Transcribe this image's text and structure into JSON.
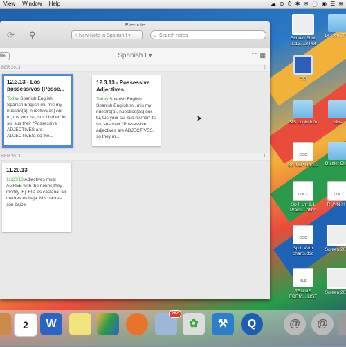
{
  "menubar": {
    "items": [
      "View",
      "Window",
      "Help"
    ],
    "status_icons": [
      "☁",
      "⊙",
      "⏱",
      "✱",
      "✉",
      "⌚",
      "◉",
      "☰",
      "≋"
    ]
  },
  "window": {
    "title": "Evernote",
    "new_note_label": "New Note in Spanish I",
    "search_placeholder": "Search notes",
    "notebook_name": "Spanish I",
    "sidebar_toggle_label": "tite"
  },
  "sections": [
    {
      "label": "BER 2013",
      "count": "2",
      "notes": [
        {
          "title": "12.3.13 - Los possessivos (Posse...",
          "date": "Today",
          "snippet": " Spanish English Spanish English mi, mis my nuestro(a), nuestros(as) our tu, tus your su, sus his/her/ its su, sus their *Possessive ADJECTIVES are ADJECTIVES, so the...",
          "selected": true
        },
        {
          "title": "12.3.13 - Possessive Adjectives",
          "date": "Today",
          "snippet": " Spanish English Spanish English mi, mis my nuestro(a), nuestros(as) our tu, tus your su, sus his/her/ its su, sus their *Possessive adjectives are ADJECTIVES, so they m...",
          "selected": false
        }
      ]
    },
    {
      "label": "BER 2013",
      "count": "1",
      "notes": [
        {
          "title": "11.20.13",
          "date": "11/20/13",
          "snippet": " Adjectives must AGREE with the nouns they modify. Ej: Ella es castaña. Mi madres es baja. Mis padres son bajos.",
          "selected": false
        }
      ]
    }
  ],
  "desktop_icons": [
    {
      "label": "Screen Shot 2013....8 PM",
      "kind": "shot"
    },
    {
      "label": "Lesson 2013",
      "kind": "folder"
    },
    {
      "label": "SIS",
      "kind": "sis"
    },
    {
      "label": "SIS Login Info",
      "kind": "folder"
    },
    {
      "label": "Mus",
      "kind": "folder"
    },
    {
      "label": "Sp II LP Un 1.2",
      "kind": "doc",
      "tag": "DOC"
    },
    {
      "label": "Quizlet Chec",
      "kind": "folder"
    },
    {
      "label": "Sp II Un 1.1 Practi....riting",
      "kind": "doc",
      "tag": "DOCX"
    },
    {
      "label": "RUNN HIL",
      "kind": "doc",
      "tag": "DOC"
    },
    {
      "label": "Sp II Verb charts.doc",
      "kind": "doc",
      "tag": "DOC"
    },
    {
      "label": "Screen 2013",
      "kind": "shot"
    },
    {
      "label": "TENNIS FORM....LIST",
      "kind": "doc",
      "tag": "XLS"
    },
    {
      "label": "Screen 2013",
      "kind": "shot"
    }
  ],
  "dock": {
    "calendar_day": "2",
    "mail_badge": "262"
  },
  "colors": {
    "accent": "#4f87dd",
    "date_green": "#4aa53c"
  }
}
